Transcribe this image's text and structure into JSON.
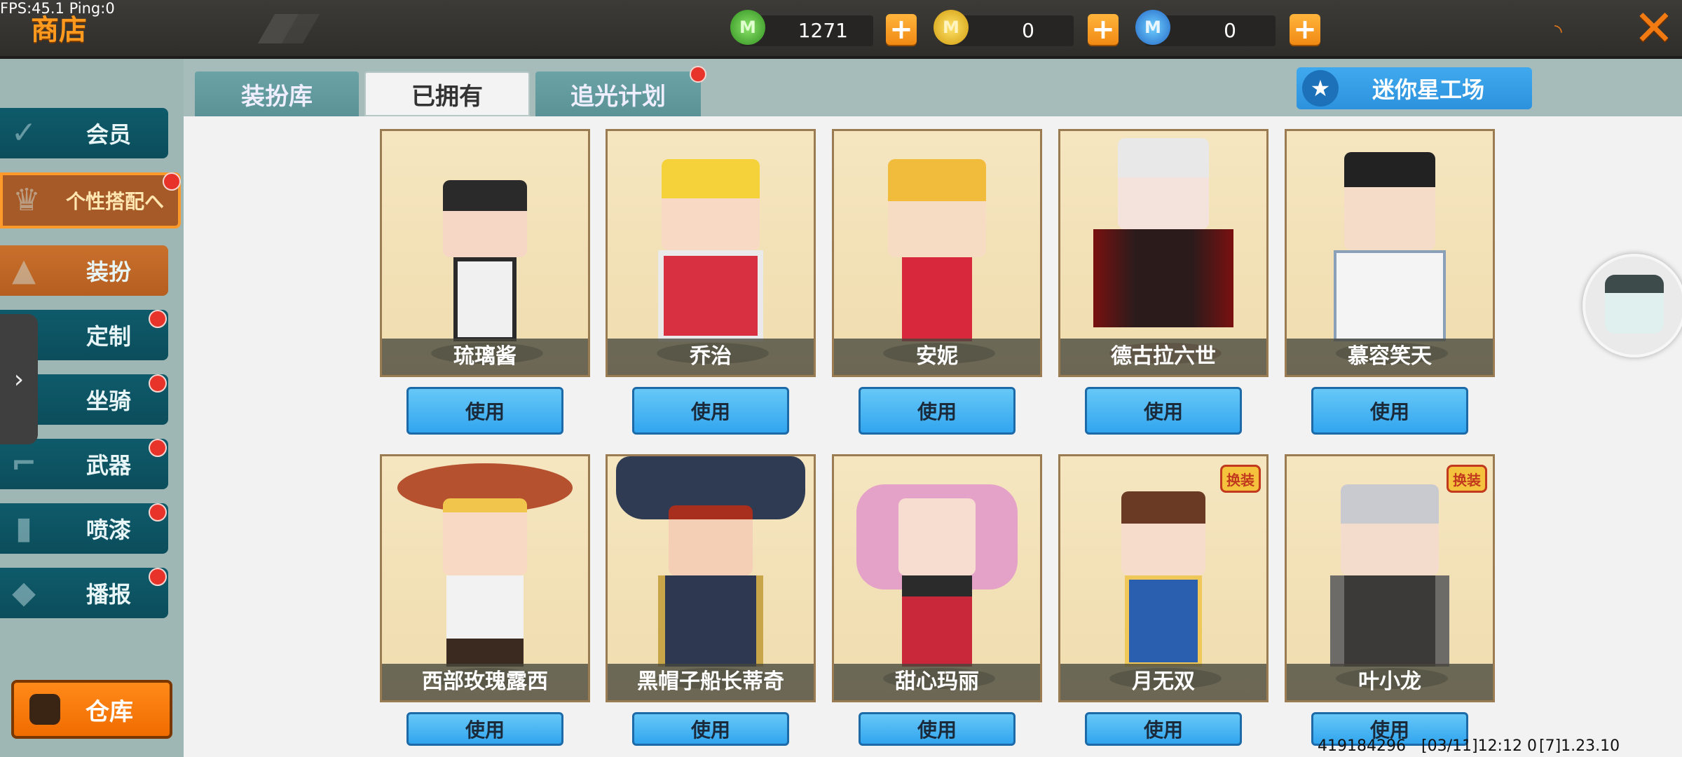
{
  "debug": {
    "fps_text": "FPS:45.1  Ping:0"
  },
  "header": {
    "title": "商店",
    "currencies": [
      {
        "icon": "green-gem-icon",
        "value": "1271"
      },
      {
        "icon": "gold-coin-icon",
        "value": "0"
      },
      {
        "icon": "blue-coin-icon",
        "value": "0"
      }
    ]
  },
  "sidebar": {
    "items": [
      {
        "label": "会员"
      },
      {
        "label": "个性搭配へ"
      },
      {
        "label": "装扮"
      },
      {
        "label": "定制"
      },
      {
        "label": "坐骑"
      },
      {
        "label": "武器"
      },
      {
        "label": "喷漆"
      },
      {
        "label": "播报"
      }
    ],
    "warehouse": "仓库",
    "drawer_arrow": "›"
  },
  "tabs": [
    {
      "label": "装扮库"
    },
    {
      "label": "已拥有"
    },
    {
      "label": "追光计划"
    }
  ],
  "star_workshop": "迷你星工场",
  "cards_row1": [
    {
      "name": "琉璃酱",
      "button": "使用"
    },
    {
      "name": "乔治",
      "button": "使用"
    },
    {
      "name": "安妮",
      "button": "使用"
    },
    {
      "name": "德古拉六世",
      "button": "使用"
    },
    {
      "name": "慕容笑天",
      "button": "使用"
    }
  ],
  "cards_row2": [
    {
      "name": "西部玫瑰露西",
      "button": "使用"
    },
    {
      "name": "黑帽子船长蒂奇",
      "button": "使用"
    },
    {
      "name": "甜心玛丽",
      "button": "使用"
    },
    {
      "name": "月无双",
      "button": "使用",
      "tag": "换装"
    },
    {
      "name": "叶小龙",
      "button": "使用",
      "tag": "换装"
    }
  ],
  "footer": {
    "uid": "419184296",
    "time": "[03/11]12:12 0",
    "version": "[7]1.23.10"
  },
  "colors": {
    "accent_orange": "#f27a12",
    "sidebar_teal": "#0f5b6b",
    "button_blue": "#32a5ef"
  }
}
